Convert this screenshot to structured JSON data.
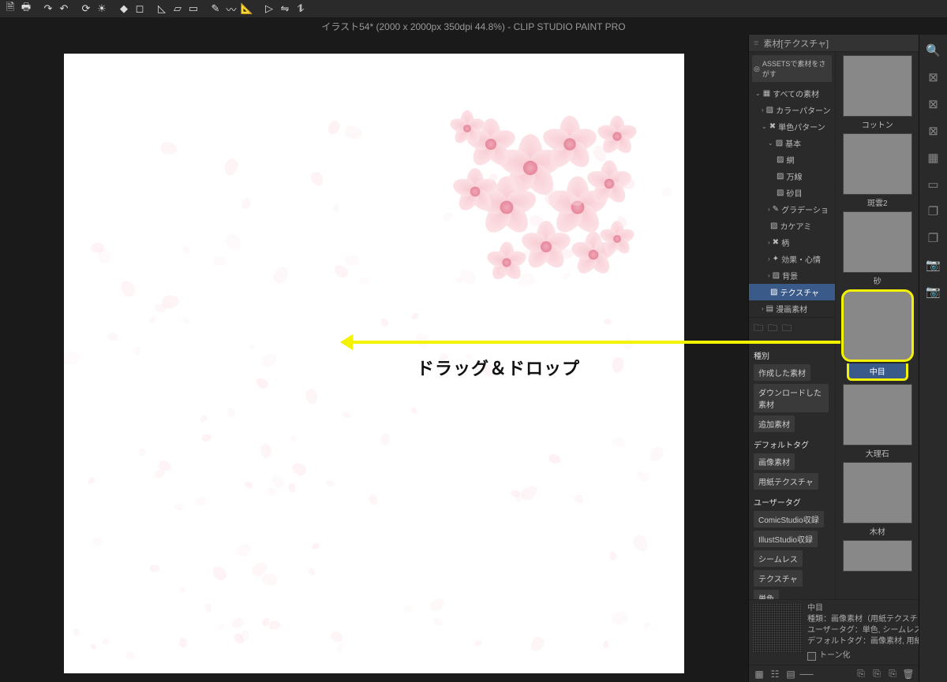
{
  "toolbar_icons": [
    "file-icon",
    "print-icon",
    "redo-icon",
    "undo-icon",
    "refresh-icon",
    "sun-icon",
    "bucket-icon",
    "crop-icon",
    "shape1-icon",
    "shape2-icon",
    "rect-icon",
    "pen-icon",
    "curve-icon",
    "ruler-icon",
    "play-icon",
    "flip-h-icon",
    "flip-v-icon"
  ],
  "title": "イラスト54* (2000 x 2000px 350dpi 44.8%)  - CLIP STUDIO PAINT PRO",
  "annotation_text": "ドラッグ＆ドロップ",
  "panel_header": "素材[テクスチャ]",
  "assets_button": "ASSETSで素材をさがす",
  "tree": [
    {
      "label": "すべての素材",
      "depth": 0,
      "caret": "⌄",
      "icon": "▦"
    },
    {
      "label": "カラーパターン",
      "depth": 1,
      "caret": "›",
      "icon": "▨"
    },
    {
      "label": "単色パターン",
      "depth": 1,
      "caret": "⌄",
      "icon": "✖"
    },
    {
      "label": "基本",
      "depth": 2,
      "caret": "⌄",
      "icon": "▨"
    },
    {
      "label": "網",
      "depth": 3,
      "caret": "",
      "icon": "▨"
    },
    {
      "label": "万線",
      "depth": 3,
      "caret": "",
      "icon": "▨"
    },
    {
      "label": "砂目",
      "depth": 3,
      "caret": "",
      "icon": "▨"
    },
    {
      "label": "グラデーショ",
      "depth": 2,
      "caret": "›",
      "icon": "✎"
    },
    {
      "label": "カケアミ",
      "depth": 2,
      "caret": "",
      "icon": "▨"
    },
    {
      "label": "柄",
      "depth": 2,
      "caret": "›",
      "icon": "✖"
    },
    {
      "label": "効果・心情",
      "depth": 2,
      "caret": "›",
      "icon": "✦"
    },
    {
      "label": "背景",
      "depth": 2,
      "caret": "›",
      "icon": "▨"
    },
    {
      "label": "テクスチャ",
      "depth": 2,
      "caret": "",
      "icon": "▨",
      "selected": true
    },
    {
      "label": "漫画素材",
      "depth": 1,
      "caret": "›",
      "icon": "▤"
    }
  ],
  "thumbs": [
    {
      "label": "コットン",
      "tex": "tex-lines"
    },
    {
      "label": "斑雲2",
      "tex": "tex-noise1"
    },
    {
      "label": "砂",
      "tex": "tex-noise2"
    },
    {
      "label": "中目",
      "tex": "tex-noise3",
      "highlighted": true
    },
    {
      "label": "大理石",
      "tex": "tex-marble"
    },
    {
      "label": "木材",
      "tex": "tex-wood"
    }
  ],
  "tag_section": {
    "type_header": "種別",
    "type_tags": [
      "作成した素材",
      "ダウンロードした素材",
      "追加素材"
    ],
    "default_header": "デフォルトタグ",
    "default_tags": [
      "画像素材",
      "用紙テクスチャ"
    ],
    "user_header": "ユーザータグ",
    "user_tags": [
      "ComicStudio収録",
      "IllustStudio収録",
      "シームレス",
      "テクスチャ",
      "単色"
    ]
  },
  "detail": {
    "name": "中目",
    "line1": "種類：画像素材（用紙テクスチャ）",
    "line2": "ユーザータグ：単色, シームレス, テク",
    "line3": "デフォルトタグ：画像素材, 用紙テク",
    "checkbox": "トーン化"
  },
  "side_icons": [
    "search-icon",
    "close-box-icon",
    "close-box-icon",
    "close-box-icon",
    "grid-icon",
    "rect-stack-icon",
    "layers-icon",
    "layers-icon",
    "camera-icon",
    "camera-icon"
  ]
}
